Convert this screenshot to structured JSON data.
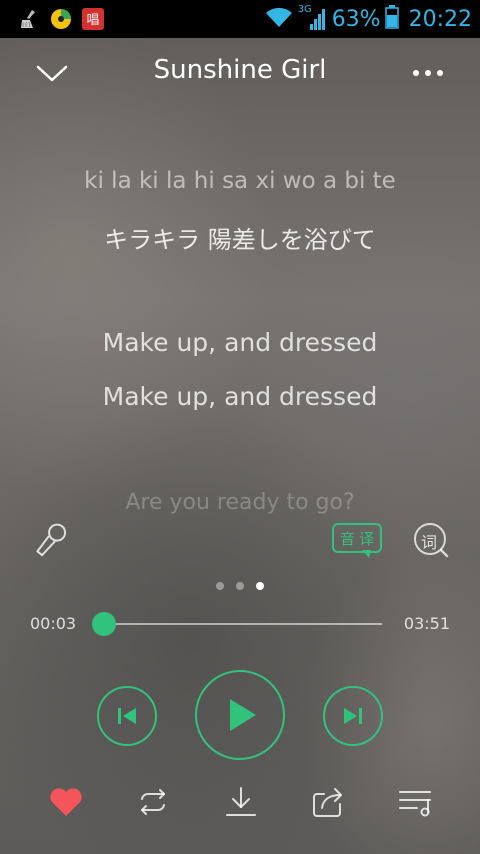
{
  "status_bar": {
    "network_type": "3G",
    "battery_percent": "63%",
    "time": "20:22",
    "notification_icons": [
      "broom-icon",
      "music-disc-icon",
      "karaoke-app-icon"
    ],
    "karaoke_glyph": "唱",
    "accent_color": "#33b5e5"
  },
  "header": {
    "title": "Sunshine Girl"
  },
  "lyrics": {
    "lines": [
      "ki la ki la  hi sa xi wo a bi te",
      "キラキラ 陽差しを浴びて",
      "Make up, and dressed",
      "Make up, and dressed",
      "Are you ready to go?"
    ]
  },
  "tools": {
    "translate_label_1": "音",
    "translate_label_2": "译",
    "lyric_search_label": "词"
  },
  "pager": {
    "count": 3,
    "active_index": 2
  },
  "progress": {
    "current_time": "00:03",
    "total_time": "03:51",
    "fraction": 0.013
  },
  "bottom_bar": {
    "icons": [
      "heart-icon",
      "repeat-icon",
      "download-icon",
      "share-icon",
      "playlist-icon"
    ],
    "liked": true
  },
  "colors": {
    "accent": "#31c27c",
    "like": "#f4545a",
    "statusbar_text": "#33b5e5"
  }
}
